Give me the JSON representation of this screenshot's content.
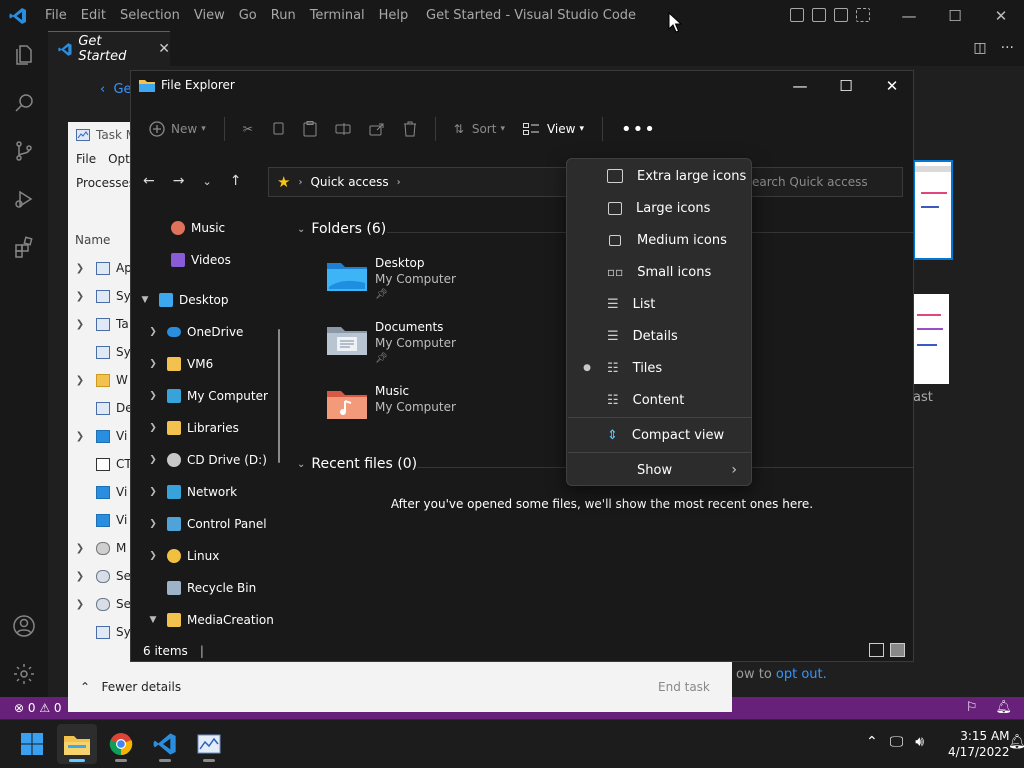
{
  "vscode": {
    "menu": [
      "File",
      "Edit",
      "Selection",
      "View",
      "Go",
      "Run",
      "Terminal",
      "Help"
    ],
    "title": "Get Started - Visual Studio Code",
    "tab_label": "Get Started",
    "tab_close": "✕",
    "breadcrumb_back": "Ge",
    "optout_prefix": "ow to ",
    "optout_link": "opt out.",
    "thumb_caption": "ast",
    "status_problems": "⊗ 0 ⚠ 0",
    "accent": "#0078d4",
    "status_color": "#68217a"
  },
  "task_manager": {
    "title": "Task M",
    "menu": [
      "File",
      "Opti"
    ],
    "tab": "Processes",
    "column_name": "Name",
    "rows": [
      "Ap",
      "Sy",
      "Ta",
      "Sy",
      "W",
      "De",
      "Vi",
      "CT",
      "Vi",
      "Vi",
      "M",
      "Se",
      "Se",
      "Sy"
    ],
    "fewer_details": "Fewer details",
    "end_task": "End task"
  },
  "file_explorer": {
    "title": "File Explorer",
    "cmd": {
      "new": "New",
      "sort": "Sort",
      "view": "View"
    },
    "address": "Quick access",
    "search_placeholder": "earch Quick access",
    "nav": {
      "music": "Music",
      "videos": "Videos",
      "desktop": "Desktop",
      "onedrive": "OneDrive",
      "vm6": "VM6",
      "mycomputer": "My Computer",
      "libraries": "Libraries",
      "cddrive": "CD Drive (D:)",
      "network": "Network",
      "controlpanel": "Control Panel",
      "linux": "Linux",
      "recyclebin": "Recycle Bin",
      "mediacreation": "MediaCreation"
    },
    "folders_header": "Folders (6)",
    "folders": [
      {
        "name": "Desktop",
        "location": "My Computer"
      },
      {
        "name": "Documents",
        "location": "My Computer"
      },
      {
        "name": "Music",
        "location": "My Computer"
      }
    ],
    "recent_header": "Recent files (0)",
    "recent_empty": "After you've opened some files, we'll show the most recent ones here.",
    "status_items": "6 items"
  },
  "view_menu": {
    "items": [
      {
        "label": "Extra large icons",
        "selected": false
      },
      {
        "label": "Large icons",
        "selected": false
      },
      {
        "label": "Medium icons",
        "selected": false
      },
      {
        "label": "Small icons",
        "selected": false
      },
      {
        "label": "List",
        "selected": false
      },
      {
        "label": "Details",
        "selected": false
      },
      {
        "label": "Tiles",
        "selected": true
      },
      {
        "label": "Content",
        "selected": false
      },
      {
        "label": "Compact view",
        "selected": false
      },
      {
        "label": "Show",
        "selected": false
      }
    ]
  },
  "taskbar": {
    "time": "3:15 AM",
    "date": "4/17/2022",
    "accent": "#60cdff"
  }
}
